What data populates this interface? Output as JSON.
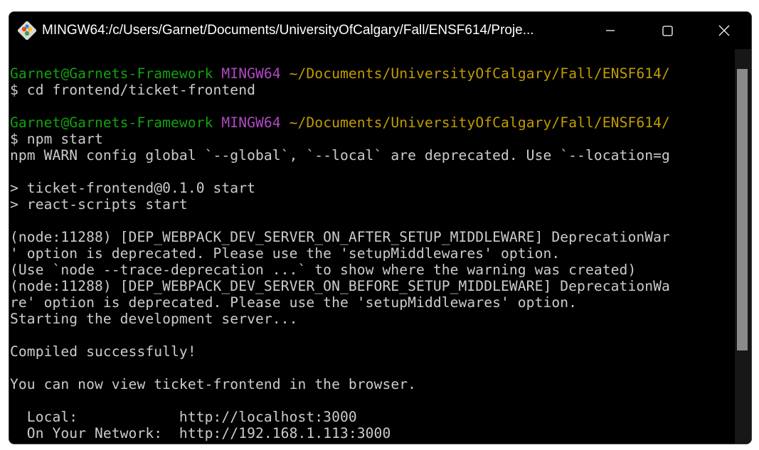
{
  "window": {
    "title": "MINGW64:/c/Users/Garnet/Documents/UniversityOfCalgary/Fall/ENSF614/Proje..."
  },
  "icons": {
    "app": "git-bash-icon",
    "minimize": "minimize-icon",
    "maximize": "maximize-icon",
    "close": "close-icon"
  },
  "colors": {
    "background": "#000000",
    "text": "#cccccc",
    "prompt_user": "#13a10e",
    "prompt_env": "#b148c6",
    "prompt_path": "#c19c00"
  },
  "terminal": {
    "lines": [
      {
        "user": "Garnet@Garnets-Framework",
        "env": "MINGW64",
        "path": "~/Documents/UniversityOfCalgary/Fall/ENSF614/"
      },
      {
        "text": "$ cd frontend/ticket-frontend"
      },
      {
        "text": ""
      },
      {
        "user": "Garnet@Garnets-Framework",
        "env": "MINGW64",
        "path": "~/Documents/UniversityOfCalgary/Fall/ENSF614/"
      },
      {
        "text": "$ npm start"
      },
      {
        "text": "npm WARN config global `--global`, `--local` are deprecated. Use `--location=g"
      },
      {
        "text": ""
      },
      {
        "text": "> ticket-frontend@0.1.0 start"
      },
      {
        "text": "> react-scripts start"
      },
      {
        "text": ""
      },
      {
        "text": "(node:11288) [DEP_WEBPACK_DEV_SERVER_ON_AFTER_SETUP_MIDDLEWARE] DeprecationWar"
      },
      {
        "text": "' option is deprecated. Please use the 'setupMiddlewares' option."
      },
      {
        "text": "(Use `node --trace-deprecation ...` to show where the warning was created)"
      },
      {
        "text": "(node:11288) [DEP_WEBPACK_DEV_SERVER_ON_BEFORE_SETUP_MIDDLEWARE] DeprecationWa"
      },
      {
        "text": "re' option is deprecated. Please use the 'setupMiddlewares' option."
      },
      {
        "text": "Starting the development server..."
      },
      {
        "text": ""
      },
      {
        "text": "Compiled successfully!"
      },
      {
        "text": ""
      },
      {
        "text": "You can now view ticket-frontend in the browser."
      },
      {
        "text": ""
      },
      {
        "text": "  Local:            http://localhost:3000"
      },
      {
        "text": "  On Your Network:  http://192.168.1.113:3000"
      }
    ]
  }
}
